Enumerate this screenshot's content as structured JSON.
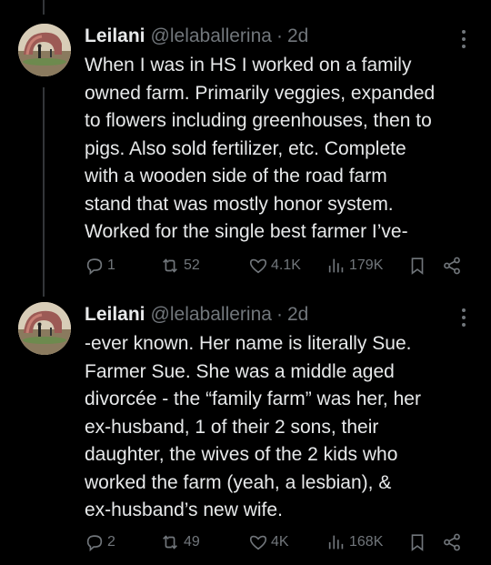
{
  "tweets": [
    {
      "display_name": "Leilani",
      "handle": "@lelaballerina",
      "separator": "·",
      "time": "2d",
      "lines": [
        "When I was in HS I worked on a family",
        "owned farm. Primarily veggies, expanded",
        "to flowers including greenhouses, then to",
        "pigs. Also sold fertilizer, etc. Complete",
        "with a wooden side of the road farm",
        "stand that was mostly honor system.",
        "Worked for the single best farmer I’ve-"
      ],
      "replies": "1",
      "reposts": "52",
      "likes": "4.1K",
      "views": "179K"
    },
    {
      "display_name": "Leilani",
      "handle": "@lelaballerina",
      "separator": "·",
      "time": "2d",
      "lines": [
        "-ever known. Her name is literally Sue.",
        "Farmer Sue. She was a middle aged",
        "divorcée - the “family farm” was her, her",
        "ex-husband, 1 of their 2 sons, their",
        "daughter, the wives of the 2 kids who",
        "worked the farm (yeah, a lesbian), &",
        "ex-husband’s new wife."
      ],
      "replies": "2",
      "reposts": "49",
      "likes": "4K",
      "views": "168K"
    }
  ],
  "colors": {
    "background": "#000000",
    "text": "#e7e9ea",
    "muted": "#71767b",
    "thread_line": "#333639"
  },
  "icons": [
    "reply-icon",
    "repost-icon",
    "like-icon",
    "views-icon",
    "bookmark-icon",
    "share-icon",
    "more-icon"
  ]
}
